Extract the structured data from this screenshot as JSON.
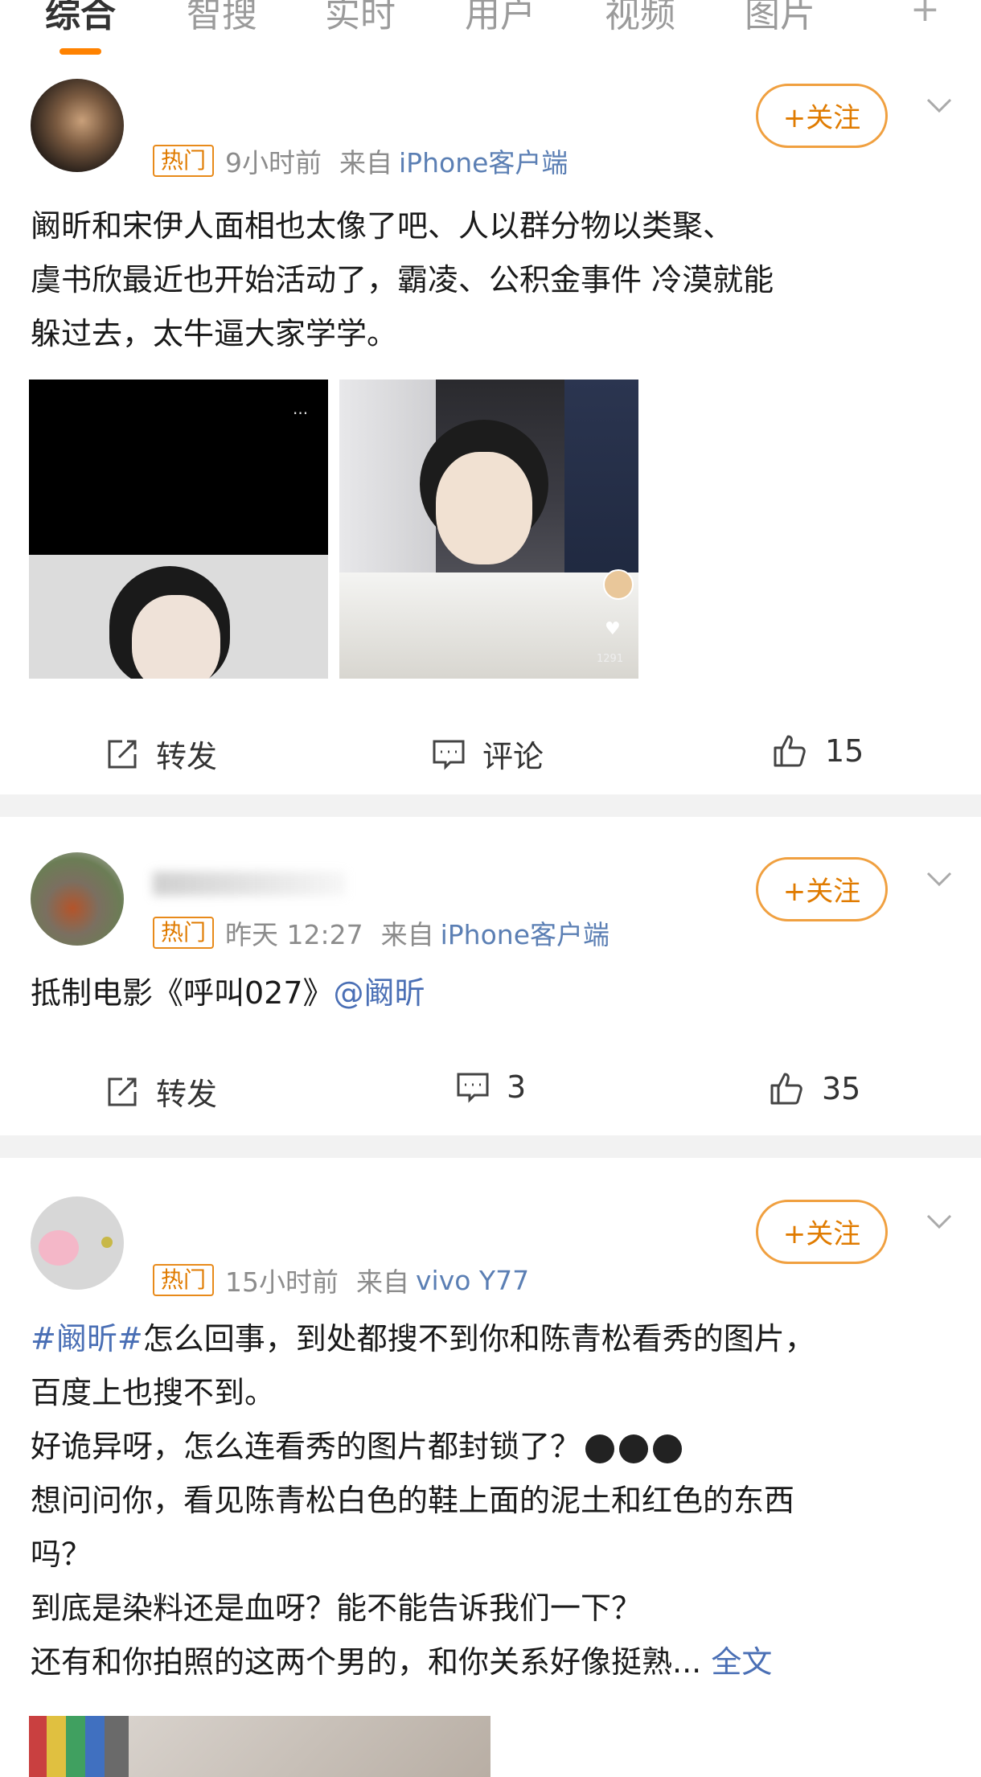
{
  "tabs": [
    {
      "label": "综合",
      "active": true
    },
    {
      "label": "智搜"
    },
    {
      "label": "实时"
    },
    {
      "label": "用户"
    },
    {
      "label": "视频"
    },
    {
      "label": "图片"
    }
  ],
  "tab_more": "+",
  "follow_label": "+关注",
  "colors": {
    "accent": "#ff8200",
    "link": "#4a6fb5",
    "hot": "#e07b00"
  },
  "posts": [
    {
      "badge": "热门",
      "time": "9小时前",
      "from_label": "来自",
      "device": "iPhone客户端",
      "lines": [
        "阚昕和宋伊人面相也太像了吧、人以群分物以类聚、",
        "虞书欣最近也开始活动了，霸凌、公积金事件  冷漠就能",
        "躲过去，太牛逼大家学学。"
      ],
      "repost_label": "转发",
      "comment_label": "评论",
      "like_count": "15",
      "images": [
        {
          "overlay": "···"
        },
        {
          "like_count_small": "1291"
        }
      ]
    },
    {
      "badge": "热门",
      "time": "昨天 12:27",
      "from_label": "来自",
      "device": "iPhone客户端",
      "text_plain": "抵制电影《呼叫027》",
      "text_mention": "@阚昕",
      "repost_label": "转发",
      "comment_count": "3",
      "like_count": "35"
    },
    {
      "badge": "热门",
      "time": "15小时前",
      "from_label": "来自",
      "device": "vivo Y77",
      "hashtag": "#阚昕#",
      "line1_rest": "怎么回事，到处都搜不到你和陈青松看秀的图片，",
      "line2": "百度上也搜不到。",
      "line3": "好诡异呀，怎么连看秀的图片都封锁了？",
      "line4": "想问问你，看见陈青松白色的鞋上面的泥土和红色的东西",
      "line5": "吗？",
      "line6": "到底是染料还是血呀？能不能告诉我们一下？",
      "line7": "还有和你拍照的这两个男的，和你关系好像挺熟...",
      "full_text_label": "全文"
    }
  ]
}
